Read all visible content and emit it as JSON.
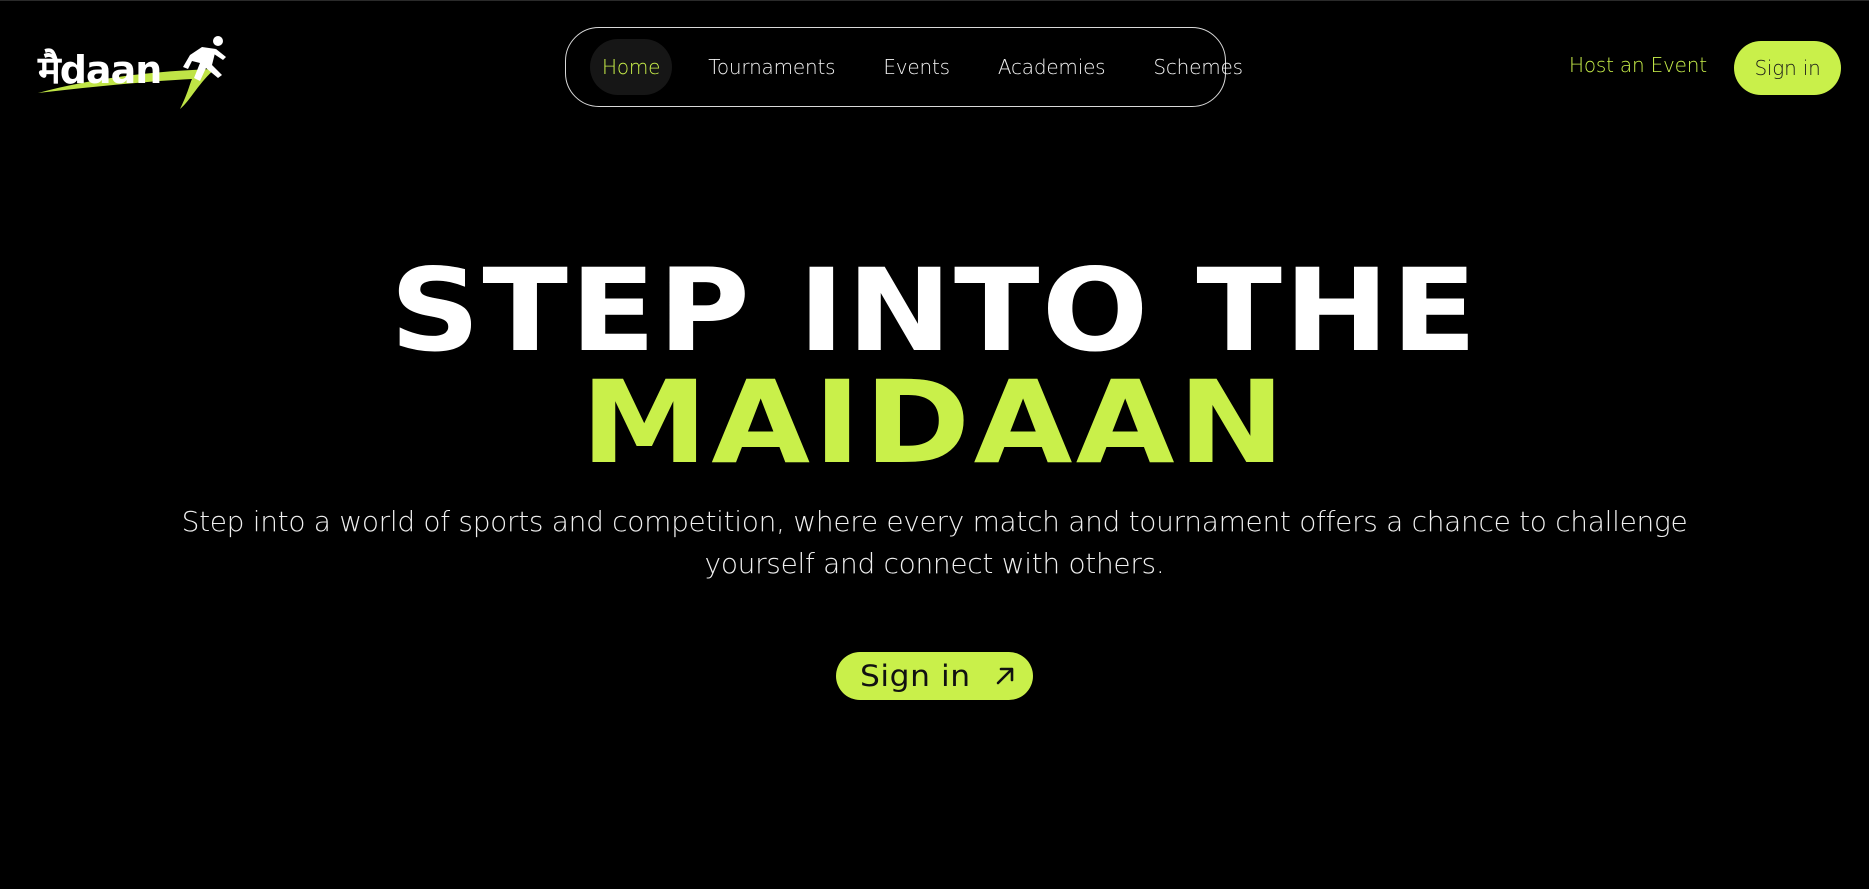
{
  "brand": {
    "logo_text": "मैdaan"
  },
  "nav": {
    "items": [
      {
        "label": "Home",
        "active": true
      },
      {
        "label": "Tournaments",
        "active": false
      },
      {
        "label": "Events",
        "active": false
      },
      {
        "label": "Academies",
        "active": false
      },
      {
        "label": "Schemes",
        "active": false
      }
    ]
  },
  "header_actions": {
    "host_label": "Host an Event",
    "signin_label": "Sign in"
  },
  "hero": {
    "line1": "STEP INTO THE",
    "line2": "MAIDAAN",
    "subtitle": "Step into a world of sports and competition, where every match and tournament offers a chance to challenge yourself and connect with others.",
    "cta_label": "Sign in",
    "cta_icon": "arrow-up-right-icon"
  },
  "colors": {
    "background": "#000000",
    "accent": "#c9f04a",
    "text": "#ffffff"
  }
}
